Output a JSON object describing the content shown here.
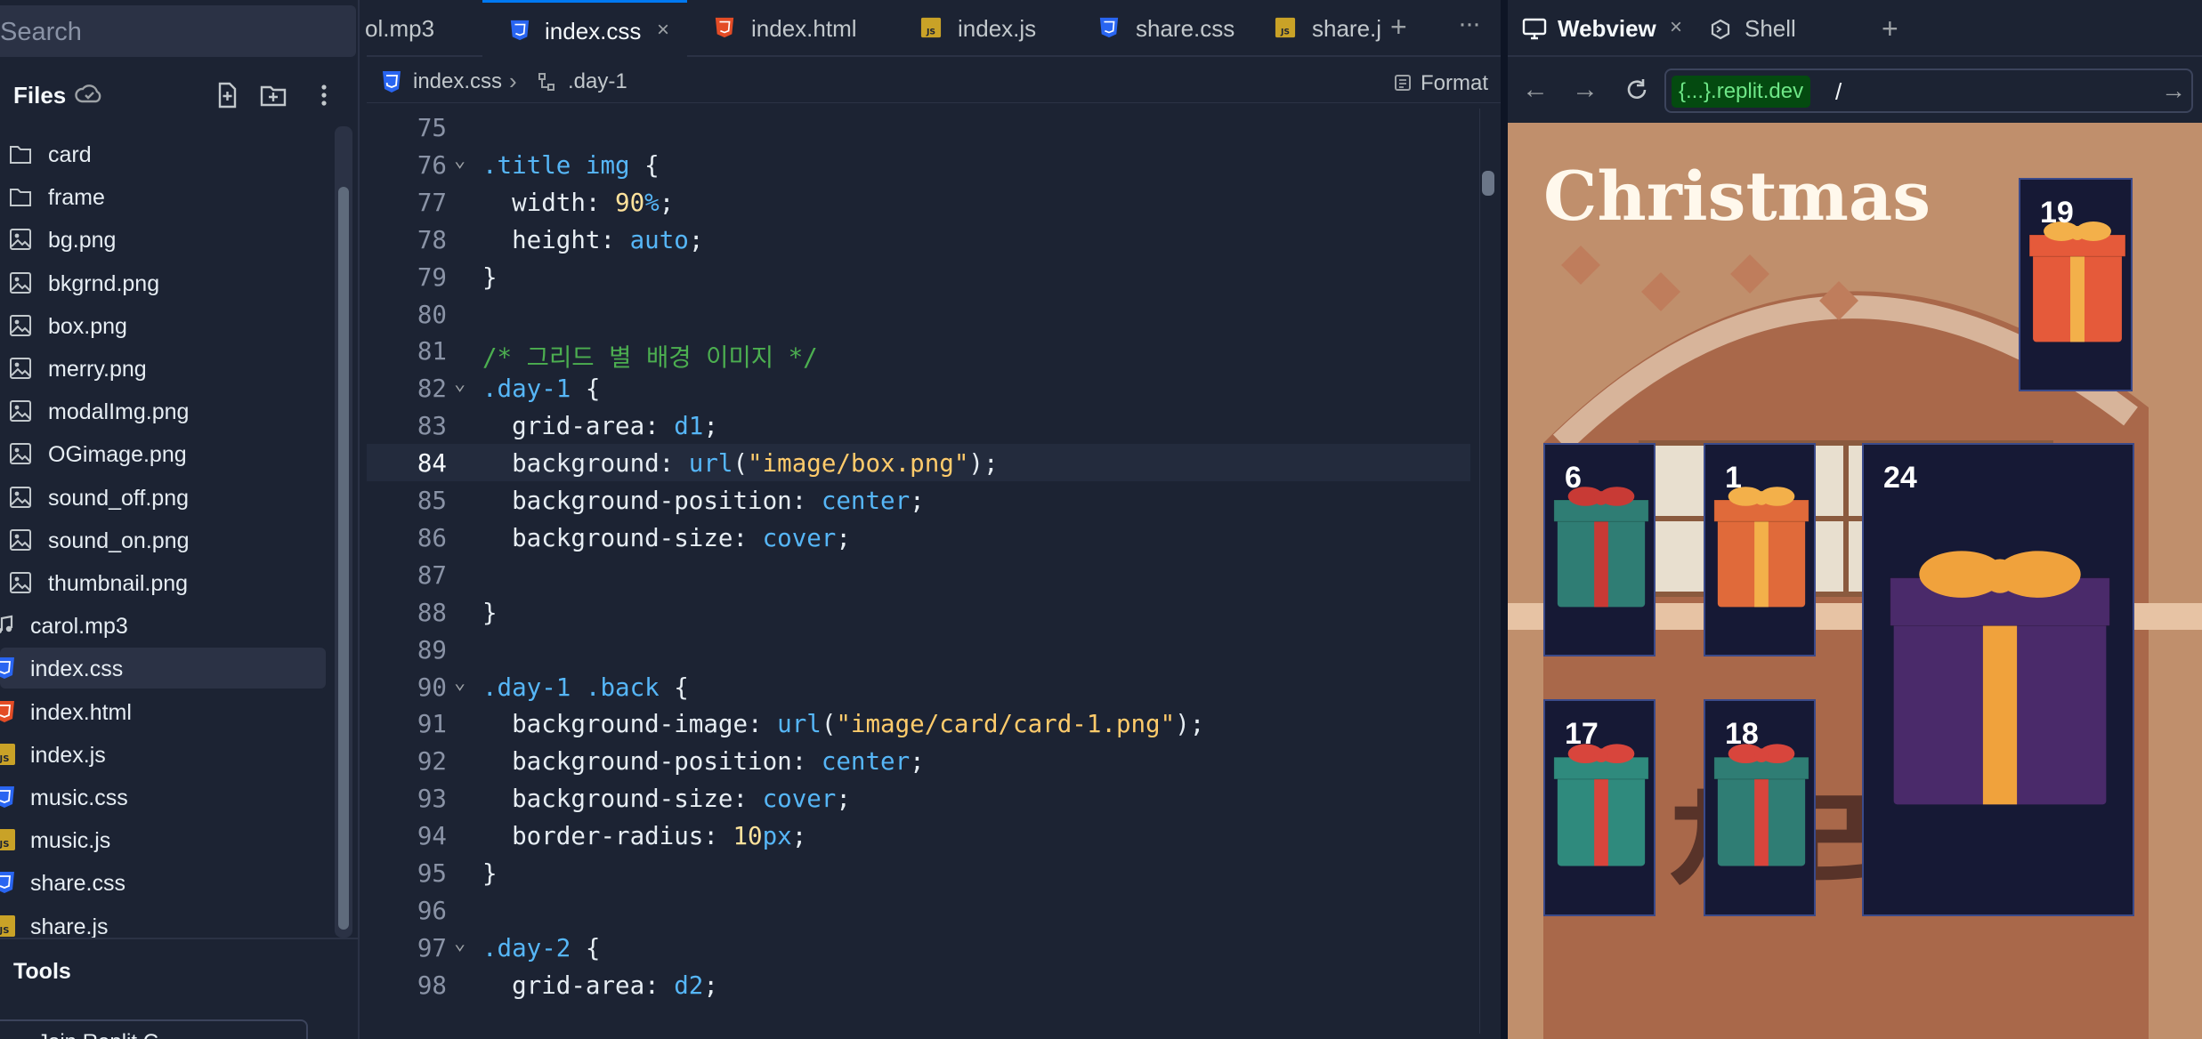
{
  "sidebar": {
    "search_placeholder": "Search",
    "files_title": "Files",
    "items": [
      {
        "label": "card",
        "icon": "folder-icon",
        "root": false
      },
      {
        "label": "frame",
        "icon": "folder-icon",
        "root": false
      },
      {
        "label": "bg.png",
        "icon": "image-icon",
        "root": false
      },
      {
        "label": "bkgrnd.png",
        "icon": "image-icon",
        "root": false
      },
      {
        "label": "box.png",
        "icon": "image-icon",
        "root": false
      },
      {
        "label": "merry.png",
        "icon": "image-icon",
        "root": false
      },
      {
        "label": "modalImg.png",
        "icon": "image-icon",
        "root": false
      },
      {
        "label": "OGimage.png",
        "icon": "image-icon",
        "root": false
      },
      {
        "label": "sound_off.png",
        "icon": "image-icon",
        "root": false
      },
      {
        "label": "sound_on.png",
        "icon": "image-icon",
        "root": false
      },
      {
        "label": "thumbnail.png",
        "icon": "image-icon",
        "root": false
      },
      {
        "label": "carol.mp3",
        "icon": "music-file-icon",
        "root": true
      },
      {
        "label": "index.css",
        "icon": "css-file-icon",
        "root": true,
        "active": true
      },
      {
        "label": "index.html",
        "icon": "html-file-icon",
        "root": true
      },
      {
        "label": "index.js",
        "icon": "js-file-icon",
        "root": true
      },
      {
        "label": "music.css",
        "icon": "css-file-icon",
        "root": true
      },
      {
        "label": "music.js",
        "icon": "js-file-icon",
        "root": true
      },
      {
        "label": "share.css",
        "icon": "css-file-icon",
        "root": true
      },
      {
        "label": "share.js",
        "icon": "js-file-icon",
        "root": true
      }
    ],
    "tools_title": "Tools",
    "join_label": "Join Replit C..."
  },
  "editor": {
    "tabs": [
      {
        "label": "ol.mp3",
        "icon": "music-file-icon"
      },
      {
        "label": "index.css",
        "icon": "css-file-icon",
        "active": true
      },
      {
        "label": "index.html",
        "icon": "html-file-icon"
      },
      {
        "label": "index.js",
        "icon": "js-file-icon"
      },
      {
        "label": "share.css",
        "icon": "css-file-icon"
      },
      {
        "label": "share.js",
        "icon": "js-file-icon"
      }
    ],
    "breadcrumb_file": "index.css",
    "breadcrumb_sep": "›",
    "breadcrumb_symbol": ".day-1",
    "format_label": "Format",
    "current_line": 84,
    "lines": [
      {
        "n": "75",
        "fold": false,
        "tokens": []
      },
      {
        "n": "76",
        "fold": true,
        "tokens": [
          [
            ".title img",
            "sel"
          ],
          [
            " {",
            "kw"
          ]
        ]
      },
      {
        "n": "77",
        "fold": false,
        "tokens": [
          [
            "  width: ",
            "kw"
          ],
          [
            "90",
            "num"
          ],
          [
            "%",
            "val"
          ],
          [
            ";",
            "kw"
          ]
        ]
      },
      {
        "n": "78",
        "fold": false,
        "tokens": [
          [
            "  height: ",
            "kw"
          ],
          [
            "auto",
            "val"
          ],
          [
            ";",
            "kw"
          ]
        ]
      },
      {
        "n": "79",
        "fold": false,
        "tokens": [
          [
            "}",
            "kw"
          ]
        ]
      },
      {
        "n": "80",
        "fold": false,
        "tokens": []
      },
      {
        "n": "81",
        "fold": false,
        "tokens": [
          [
            "/* 그리드 별 배경 이미지 */",
            "cmt"
          ]
        ]
      },
      {
        "n": "82",
        "fold": true,
        "tokens": [
          [
            ".day-1",
            "sel"
          ],
          [
            " {",
            "kw"
          ]
        ]
      },
      {
        "n": "83",
        "fold": false,
        "tokens": [
          [
            "  grid-area: ",
            "kw"
          ],
          [
            "d1",
            "val"
          ],
          [
            ";",
            "kw"
          ]
        ]
      },
      {
        "n": "84",
        "fold": false,
        "tokens": [
          [
            "  background: ",
            "kw"
          ],
          [
            "url",
            "val"
          ],
          [
            "(",
            "kw"
          ],
          [
            "\"image/box.png\"",
            "str"
          ],
          [
            ");",
            "kw"
          ]
        ]
      },
      {
        "n": "85",
        "fold": false,
        "tokens": [
          [
            "  background-position: ",
            "kw"
          ],
          [
            "center",
            "val"
          ],
          [
            ";",
            "kw"
          ]
        ]
      },
      {
        "n": "86",
        "fold": false,
        "tokens": [
          [
            "  background-size: ",
            "kw"
          ],
          [
            "cover",
            "val"
          ],
          [
            ";",
            "kw"
          ]
        ]
      },
      {
        "n": "87",
        "fold": false,
        "tokens": []
      },
      {
        "n": "88",
        "fold": false,
        "tokens": [
          [
            "}",
            "kw"
          ]
        ]
      },
      {
        "n": "89",
        "fold": false,
        "tokens": []
      },
      {
        "n": "90",
        "fold": true,
        "tokens": [
          [
            ".day-1 .back",
            "sel"
          ],
          [
            " {",
            "kw"
          ]
        ]
      },
      {
        "n": "91",
        "fold": false,
        "tokens": [
          [
            "  background-image: ",
            "kw"
          ],
          [
            "url",
            "val"
          ],
          [
            "(",
            "kw"
          ],
          [
            "\"image/card/card-1.png\"",
            "str"
          ],
          [
            ");",
            "kw"
          ]
        ]
      },
      {
        "n": "92",
        "fold": false,
        "tokens": [
          [
            "  background-position: ",
            "kw"
          ],
          [
            "center",
            "val"
          ],
          [
            ";",
            "kw"
          ]
        ]
      },
      {
        "n": "93",
        "fold": false,
        "tokens": [
          [
            "  background-size: ",
            "kw"
          ],
          [
            "cover",
            "val"
          ],
          [
            ";",
            "kw"
          ]
        ]
      },
      {
        "n": "94",
        "fold": false,
        "tokens": [
          [
            "  border-radius: ",
            "kw"
          ],
          [
            "10",
            "num"
          ],
          [
            "px",
            "val"
          ],
          [
            ";",
            "kw"
          ]
        ]
      },
      {
        "n": "95",
        "fold": false,
        "tokens": [
          [
            "}",
            "kw"
          ]
        ]
      },
      {
        "n": "96",
        "fold": false,
        "tokens": []
      },
      {
        "n": "97",
        "fold": true,
        "tokens": [
          [
            ".day-2",
            "sel"
          ],
          [
            " {",
            "kw"
          ]
        ]
      },
      {
        "n": "98",
        "fold": false,
        "tokens": [
          [
            "  grid-area: ",
            "kw"
          ],
          [
            "d2",
            "val"
          ],
          [
            ";",
            "kw"
          ]
        ]
      }
    ]
  },
  "webview": {
    "tabs": [
      {
        "label": "Webview",
        "icon": "monitor-icon",
        "active": true
      },
      {
        "label": "Shell",
        "icon": "shell-icon"
      }
    ],
    "url_host": "{...}.replit.dev",
    "url_path": "/",
    "page": {
      "heading": "Christmas",
      "days": [
        "6",
        "1",
        "24",
        "17",
        "18",
        "19"
      ]
    }
  },
  "colors": {
    "accent": "#0079f2",
    "bg": "#1c2333",
    "panel": "#2b3245"
  }
}
